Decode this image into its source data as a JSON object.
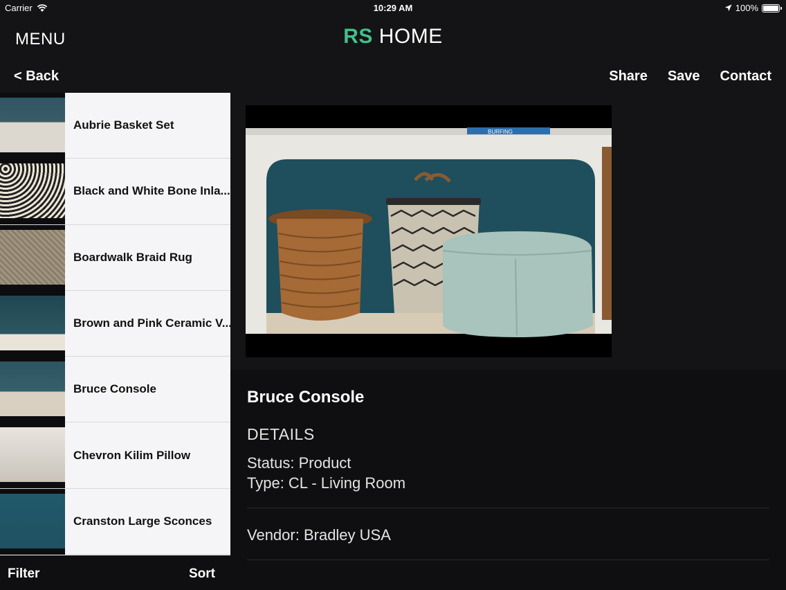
{
  "status_bar": {
    "carrier": "Carrier",
    "wifi_icon": "wifi-icon",
    "time": "10:29 AM",
    "location_icon": "location-arrow-icon",
    "battery": "100%"
  },
  "nav": {
    "menu_label": "MENU",
    "logo_rs": "RS",
    "logo_home": " HOME",
    "back_label": "< Back",
    "share_label": "Share",
    "save_label": "Save",
    "contact_label": "Contact"
  },
  "list": {
    "items": [
      {
        "label": "Aubrie Basket Set"
      },
      {
        "label": "Black and White Bone Inla..."
      },
      {
        "label": "Boardwalk Braid Rug"
      },
      {
        "label": "Brown and Pink Ceramic V..."
      },
      {
        "label": "Bruce Console"
      },
      {
        "label": "Chevron Kilim Pillow"
      },
      {
        "label": "Cranston Large Sconces"
      }
    ]
  },
  "footer": {
    "filter_label": "Filter",
    "sort_label": "Sort"
  },
  "detail": {
    "title": "Bruce Console",
    "details_heading": "DETAILS",
    "status": "Status: Product",
    "type": "Type: CL - Living Room",
    "vendor": "Vendor: Bradley USA",
    "hero_book_text": "BURFING"
  },
  "colors": {
    "brand_green": "#43c08a",
    "background": "#141416",
    "list_background": "#f5f5f7"
  }
}
